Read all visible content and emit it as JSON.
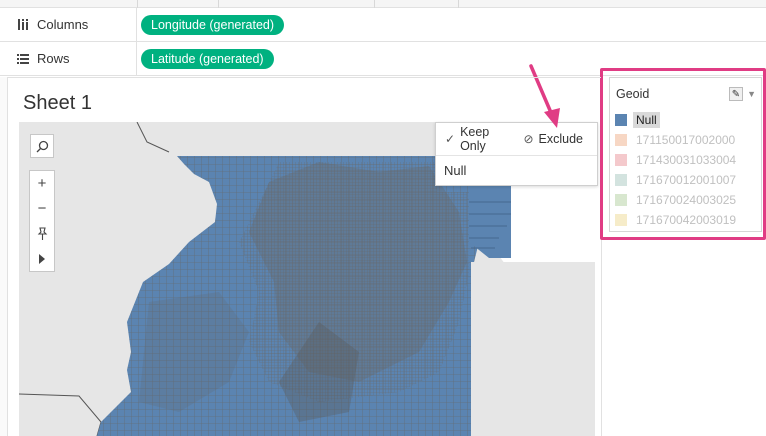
{
  "shelves": {
    "columns": {
      "label": "Columns",
      "icon": "columns-icon",
      "pill": "Longitude (generated)"
    },
    "rows": {
      "label": "Rows",
      "icon": "rows-icon",
      "pill": "Latitude (generated)"
    }
  },
  "sheet": {
    "title": "Sheet 1"
  },
  "tooltip": {
    "keep_only": "Keep Only",
    "exclude": "Exclude",
    "value": "Null"
  },
  "legend": {
    "title": "Geoid",
    "items": [
      {
        "label": "Null",
        "color": "#5b84b1",
        "state": "active"
      },
      {
        "label": "171150017002000",
        "color": "#f7d7c4",
        "state": "dim"
      },
      {
        "label": "171430031033004",
        "color": "#f4c9cc",
        "state": "dim"
      },
      {
        "label": "171670012001007",
        "color": "#d3e3df",
        "state": "dim"
      },
      {
        "label": "171670024003025",
        "color": "#d8e7cf",
        "state": "dim"
      },
      {
        "label": "171670042003019",
        "color": "#f6ecc9",
        "state": "dim"
      }
    ]
  },
  "colors": {
    "pill": "#00b180",
    "highlight_border": "#e03c84",
    "map_fill": "#5b84b1",
    "map_background": "#e8e8e8",
    "lake": "#ffffff"
  }
}
